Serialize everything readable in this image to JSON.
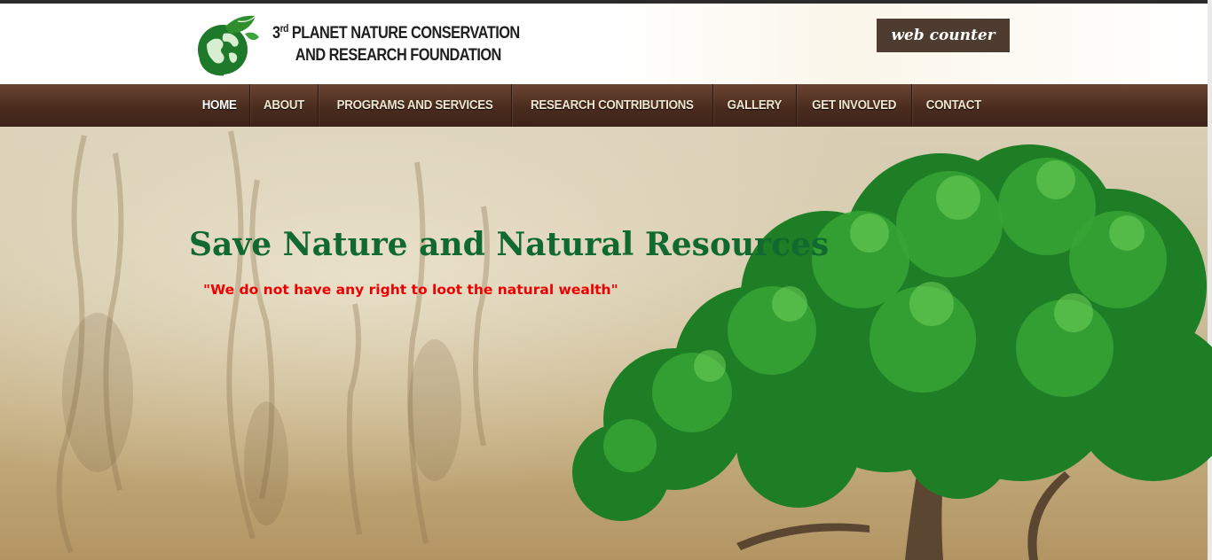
{
  "header": {
    "brand_sup": "rd",
    "brand_line1_prefix": "3",
    "brand_line1_rest": "PLANET NATURE CONSERVATION",
    "brand_line2": "AND RESEARCH FOUNDATION",
    "counter_label": "web counter",
    "logo_icon": "globe-leaf-logo"
  },
  "nav": {
    "items": [
      {
        "label": "HOME"
      },
      {
        "label": "ABOUT"
      },
      {
        "label": "PROGRAMS AND SERVICES"
      },
      {
        "label": "RESEARCH CONTRIBUTIONS"
      },
      {
        "label": "GALLERY"
      },
      {
        "label": "GET INVOLVED"
      },
      {
        "label": "CONTACT"
      }
    ]
  },
  "hero": {
    "title": "Save Nature and Natural Resources",
    "subtitle": "\"We do not have any right to loot the natural wealth\""
  },
  "colors": {
    "nav_bg": "#4a2c1e",
    "title_green": "#10692e",
    "subtitle_red": "#ee0000",
    "counter_bg": "#4e3c31"
  }
}
